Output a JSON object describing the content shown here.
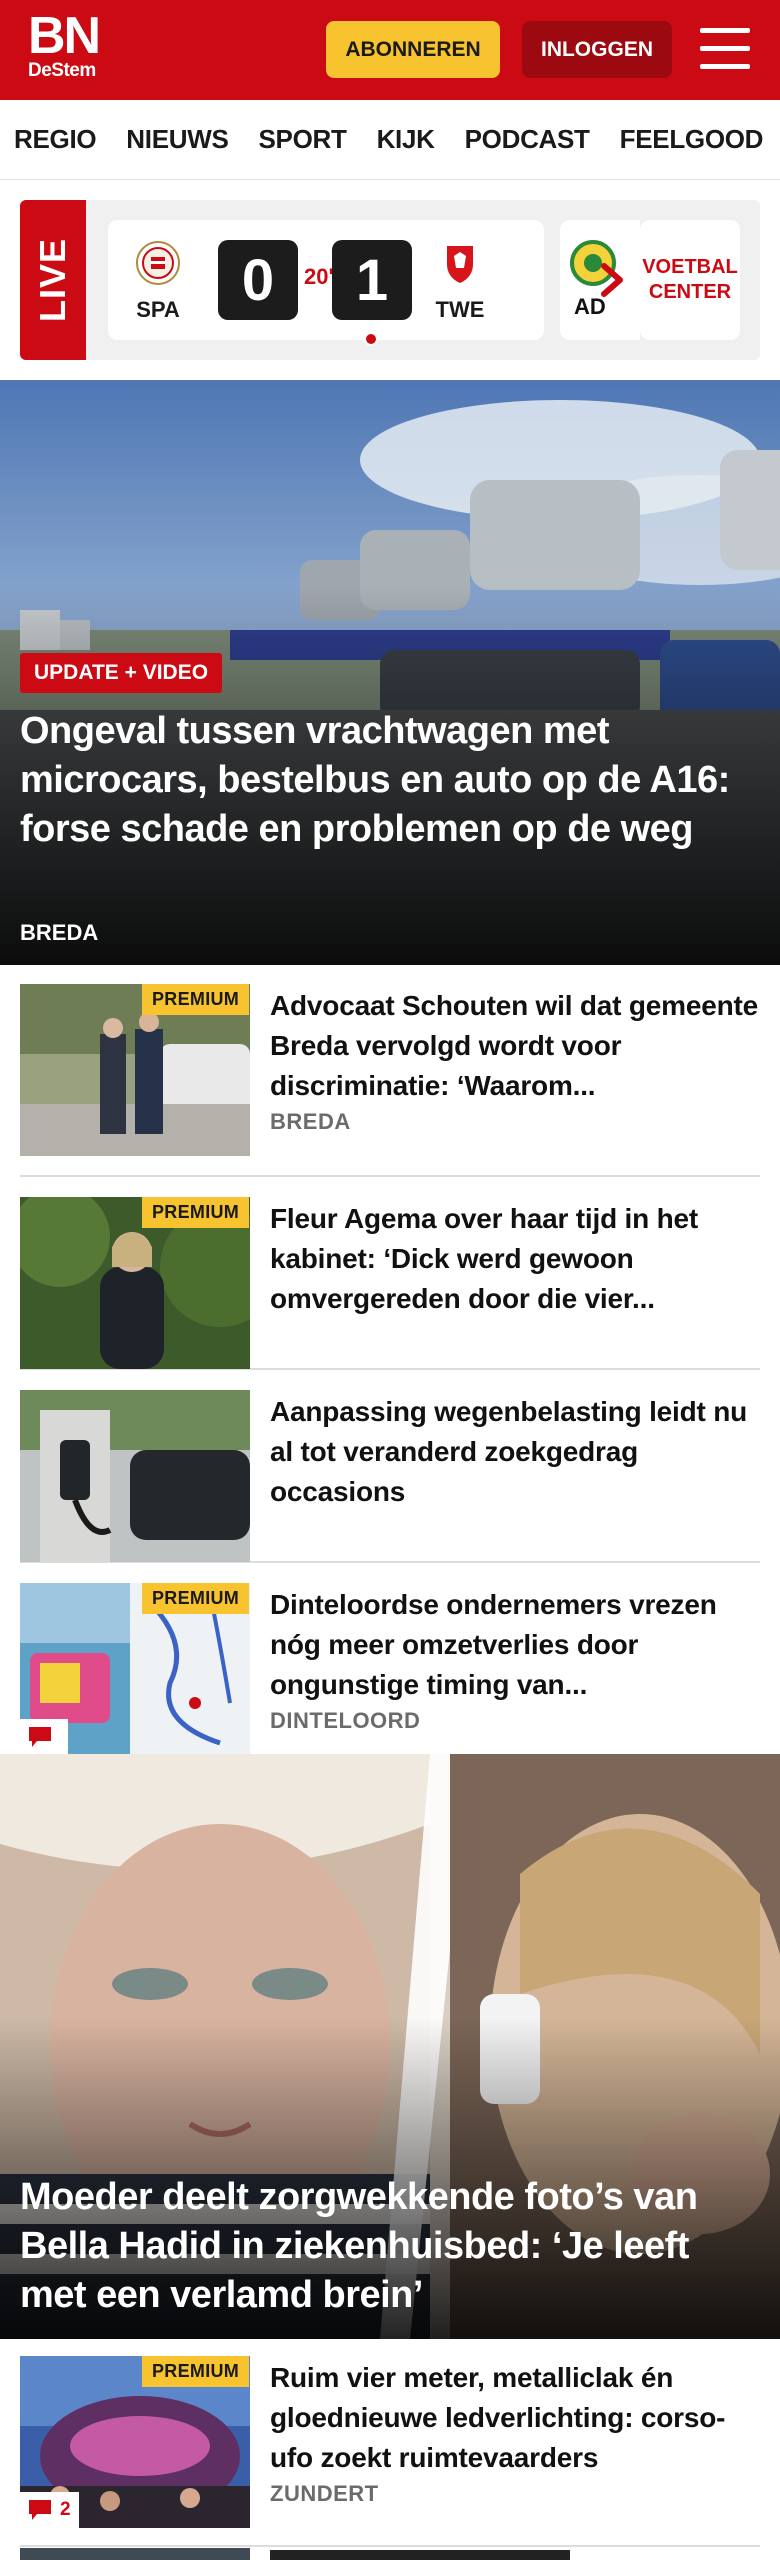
{
  "header": {
    "logo_top": "BN",
    "logo_bottom": "DeStem",
    "subscribe_label": "ABONNEREN",
    "login_label": "INLOGGEN",
    "menu_icon": "hamburger-menu-icon",
    "brand_color": "#cc0a13",
    "accent_color": "#f7c32e"
  },
  "nav": {
    "items": [
      "REGIO",
      "NIEUWS",
      "SPORT",
      "KIJK",
      "PODCAST",
      "FEELGOOD"
    ]
  },
  "live": {
    "label": "LIVE",
    "match": {
      "home_code": "SPA",
      "home_score": "0",
      "minute": "20'",
      "away_score": "1",
      "away_code": "TWE"
    },
    "next_match_code": "AD",
    "voetbal_center": "VOETBAL CENTER"
  },
  "hero": {
    "badge": "UPDATE + VIDEO",
    "title": "Ongeval tussen vrachtwagen met microcars, bestelbus en auto op de A16: forse schade en problemen op de weg",
    "location": "BREDA"
  },
  "articles": [
    {
      "premium": "PREMIUM",
      "title": "Advocaat Schouten wil dat gemeente Breda vervolgd wordt voor discriminatie: ‘Waarom...",
      "location": "BREDA"
    },
    {
      "premium": "PREMIUM",
      "title": "Fleur Agema over haar tijd in het kabinet: ‘Dick werd gewoon omvergereden door die vier...",
      "location": ""
    },
    {
      "premium": "",
      "title": "Aanpassing wegenbelasting leidt nu al tot veranderd zoekgedrag occasions",
      "location": ""
    },
    {
      "premium": "PREMIUM",
      "title": "Dinteloordse ondernemers vrezen nóg meer omzetverlies door ongunstige timing van...",
      "location": "DINTELOORD",
      "comments": ""
    }
  ],
  "hero2": {
    "title": "Moeder deelt zorgwekkende foto’s van Bella Hadid in ziekenhuisbed: ‘Je leeft met een verlamd brein’"
  },
  "articles2": [
    {
      "premium": "PREMIUM",
      "title": "Ruim vier meter, metalliclak én gloednieuwe ledverlichting: corso-ufo zoekt ruimtevaarders",
      "location": "ZUNDERT",
      "comments": "2"
    }
  ]
}
